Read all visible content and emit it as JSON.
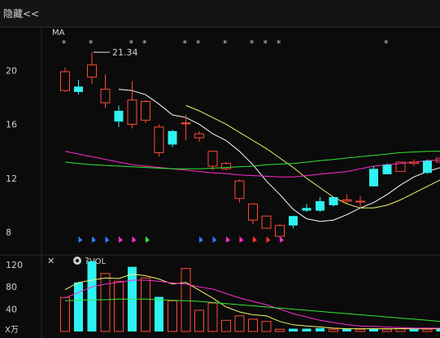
{
  "toolbar": {
    "hide_label": "隐藏<<"
  },
  "price_panel": {
    "indicator_label": "MA",
    "marker_symbol": "*",
    "high_annotation": "21.34"
  },
  "volume_panel": {
    "indicator_label": "VOL",
    "help_label": "?",
    "close_label": "✕",
    "unit_label": "X万"
  },
  "colors": {
    "up": "#ff4b3a",
    "down": "#2ff2f2",
    "ma5": "#ffffff",
    "ma10": "#f3f36a",
    "ma20": "#ff2bd0",
    "ma60": "#33e833",
    "flag_blue": "#2f7dff",
    "flag_pink": "#ff2bd0",
    "flag_red": "#ff3333",
    "flag_green": "#33e833"
  },
  "chart_data": [
    {
      "type": "candlestick",
      "title": "",
      "ylim": [
        6.8,
        22.8
      ],
      "yticks": [
        8,
        12,
        16,
        20
      ],
      "candles": [
        {
          "o": 18.5,
          "c": 19.9,
          "h": 20.2,
          "l": 18.4
        },
        {
          "o": 18.8,
          "c": 18.4,
          "h": 19.3,
          "l": 18.2
        },
        {
          "o": 19.5,
          "c": 20.4,
          "h": 21.34,
          "l": 19.0
        },
        {
          "o": 17.6,
          "c": 18.6,
          "h": 19.7,
          "l": 17.2
        },
        {
          "o": 17.0,
          "c": 16.2,
          "h": 17.4,
          "l": 15.8
        },
        {
          "o": 16.0,
          "c": 17.8,
          "h": 19.2,
          "l": 15.7
        },
        {
          "o": 16.3,
          "c": 17.7,
          "h": 17.8,
          "l": 16.1
        },
        {
          "o": 13.9,
          "c": 15.8,
          "h": 16.0,
          "l": 13.6
        },
        {
          "o": 15.5,
          "c": 14.5,
          "h": 15.6,
          "l": 14.3
        },
        {
          "o": 16.1,
          "c": 16.1,
          "h": 16.7,
          "l": 14.8
        },
        {
          "o": 15.0,
          "c": 15.3,
          "h": 15.5,
          "l": 14.7
        },
        {
          "o": 12.9,
          "c": 14.0,
          "h": 14.0,
          "l": 12.6
        },
        {
          "o": 12.7,
          "c": 13.1,
          "h": 13.2,
          "l": 12.6
        },
        {
          "o": 10.5,
          "c": 11.8,
          "h": 11.9,
          "l": 10.2
        },
        {
          "o": 8.9,
          "c": 10.1,
          "h": 10.1,
          "l": 8.6
        },
        {
          "o": 8.3,
          "c": 9.2,
          "h": 9.2,
          "l": 8.3
        },
        {
          "o": 7.7,
          "c": 8.5,
          "h": 8.6,
          "l": 7.6
        },
        {
          "o": 9.2,
          "c": 8.5,
          "h": 9.2,
          "l": 8.3
        },
        {
          "o": 9.8,
          "c": 9.6,
          "h": 10.1,
          "l": 9.5
        },
        {
          "o": 10.3,
          "c": 9.6,
          "h": 10.6,
          "l": 9.5
        },
        {
          "o": 10.6,
          "c": 10.0,
          "h": 10.6,
          "l": 9.9
        },
        {
          "o": 10.3,
          "c": 10.4,
          "h": 10.8,
          "l": 10.1
        },
        {
          "o": 10.3,
          "c": 10.3,
          "h": 10.7,
          "l": 9.9
        },
        {
          "o": 12.7,
          "c": 11.4,
          "h": 12.9,
          "l": 11.4
        },
        {
          "o": 13.0,
          "c": 12.3,
          "h": 13.1,
          "l": 12.3
        },
        {
          "o": 12.5,
          "c": 13.2,
          "h": 13.2,
          "l": 12.5
        },
        {
          "o": 13.1,
          "c": 13.2,
          "h": 13.4,
          "l": 12.9
        },
        {
          "o": 13.3,
          "c": 12.4,
          "h": 13.4,
          "l": 12.3
        },
        {
          "o": 13.2,
          "c": 13.5,
          "h": 13.5,
          "l": 13.0
        },
        {
          "o": 12.6,
          "c": 13.4,
          "h": 13.5,
          "l": 12.4
        }
      ],
      "ma_lines": [
        {
          "name": "MA5",
          "values": [
            null,
            null,
            null,
            null,
            18.6,
            18.5,
            18.2,
            17.5,
            16.7,
            16.5,
            16.0,
            15.3,
            14.8,
            14.0,
            13.0,
            11.8,
            10.8,
            9.7,
            9.0,
            8.8,
            8.9,
            9.3,
            9.8,
            10.2,
            10.8,
            11.5,
            12.1,
            12.5,
            12.8,
            13.0
          ]
        },
        {
          "name": "MA10",
          "values": [
            null,
            null,
            null,
            null,
            null,
            null,
            null,
            null,
            null,
            17.4,
            17.0,
            16.5,
            16.0,
            15.4,
            14.8,
            14.2,
            13.5,
            12.8,
            12.0,
            11.3,
            10.6,
            10.1,
            9.8,
            9.8,
            10.0,
            10.4,
            10.9,
            11.4,
            11.9,
            12.3
          ]
        },
        {
          "name": "MA20",
          "values": [
            14.0,
            13.8,
            13.6,
            13.4,
            13.2,
            13.0,
            12.9,
            12.8,
            12.7,
            12.6,
            12.5,
            12.4,
            12.35,
            12.25,
            12.2,
            12.15,
            12.1,
            12.1,
            12.2,
            12.3,
            12.4,
            12.5,
            12.7,
            12.9,
            13.0,
            13.1,
            13.2,
            13.3,
            13.35,
            13.4
          ]
        },
        {
          "name": "MA60",
          "values": [
            13.2,
            13.1,
            13.0,
            12.95,
            12.9,
            12.85,
            12.8,
            12.75,
            12.7,
            12.7,
            12.7,
            12.75,
            12.8,
            12.85,
            12.9,
            13.0,
            13.05,
            13.1,
            13.2,
            13.3,
            13.4,
            13.5,
            13.6,
            13.7,
            13.8,
            13.9,
            13.95,
            14.0,
            14.0,
            14.0
          ]
        }
      ],
      "star_markers": [
        0,
        2,
        5,
        6,
        9,
        10,
        12,
        14,
        15,
        16,
        24
      ],
      "high_label_value": 21.34,
      "flags": [
        {
          "i": 1,
          "color": "flag_blue"
        },
        {
          "i": 2,
          "color": "flag_blue"
        },
        {
          "i": 3,
          "color": "flag_blue"
        },
        {
          "i": 4,
          "color": "flag_pink"
        },
        {
          "i": 5,
          "color": "flag_pink"
        },
        {
          "i": 6,
          "color": "flag_green"
        },
        {
          "i": 10,
          "color": "flag_blue"
        },
        {
          "i": 11,
          "color": "flag_blue"
        },
        {
          "i": 12,
          "color": "flag_pink"
        },
        {
          "i": 13,
          "color": "flag_pink"
        },
        {
          "i": 14,
          "color": "flag_red"
        },
        {
          "i": 15,
          "color": "flag_red"
        },
        {
          "i": 16,
          "color": "flag_pink"
        }
      ]
    },
    {
      "type": "bar",
      "title": "",
      "ylabel": "X万",
      "ylim": [
        0,
        130
      ],
      "yticks": [
        40,
        80,
        120
      ],
      "volumes": [
        {
          "v": 61,
          "up": true
        },
        {
          "v": 88,
          "up": false
        },
        {
          "v": 126,
          "up": false
        },
        {
          "v": 104,
          "up": true
        },
        {
          "v": 90,
          "up": true
        },
        {
          "v": 116,
          "up": false
        },
        {
          "v": 96,
          "up": true
        },
        {
          "v": 62,
          "up": false
        },
        {
          "v": 55,
          "up": true
        },
        {
          "v": 113,
          "up": true
        },
        {
          "v": 38,
          "up": true
        },
        {
          "v": 51,
          "up": true
        },
        {
          "v": 20,
          "up": true
        },
        {
          "v": 28,
          "up": true
        },
        {
          "v": 22,
          "up": true
        },
        {
          "v": 18,
          "up": true
        },
        {
          "v": 4,
          "up": true
        },
        {
          "v": 5,
          "up": false
        },
        {
          "v": 5,
          "up": false
        },
        {
          "v": 6,
          "up": false
        },
        {
          "v": 4,
          "up": true
        },
        {
          "v": 5,
          "up": false
        },
        {
          "v": 4,
          "up": true
        },
        {
          "v": 5,
          "up": false
        },
        {
          "v": 4,
          "up": true
        },
        {
          "v": 5,
          "up": true
        },
        {
          "v": 5,
          "up": false
        },
        {
          "v": 4,
          "up": true
        },
        {
          "v": 6,
          "up": false
        },
        {
          "v": 6,
          "up": true
        }
      ],
      "vol_ma_lines": [
        {
          "name": "VOL MA5",
          "color": "ma10",
          "values": [
            75,
            88,
            92,
            96,
            95,
            103,
            100,
            94,
            85,
            88,
            74,
            60,
            44,
            35,
            30,
            28,
            18,
            12,
            10,
            8,
            6,
            5,
            5,
            5,
            5,
            5,
            5,
            5,
            5,
            5
          ]
        },
        {
          "name": "VOL MA10",
          "color": "ma20",
          "values": [
            60,
            70,
            80,
            85,
            88,
            92,
            92,
            90,
            87,
            85,
            80,
            76,
            68,
            60,
            54,
            48,
            40,
            32,
            26,
            20,
            16,
            12,
            10,
            9,
            8,
            7,
            6,
            6,
            6,
            6
          ]
        },
        {
          "name": "VOL MA20",
          "color": "ma60",
          "values": [
            55,
            56,
            57,
            57,
            58,
            58,
            58,
            57,
            56,
            55,
            54,
            52,
            50,
            48,
            46,
            44,
            42,
            40,
            38,
            36,
            34,
            32,
            30,
            28,
            26,
            24,
            22,
            20,
            18,
            17
          ]
        }
      ]
    }
  ]
}
